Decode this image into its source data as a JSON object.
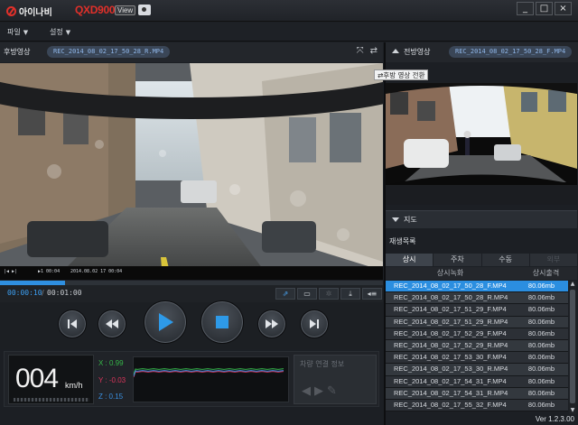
{
  "app": {
    "logo_text": "아이나비",
    "model": "QXD900",
    "view_badge": "View",
    "version": "Ver 1.2.3.00"
  },
  "window_buttons": [
    "_",
    "□",
    "×"
  ],
  "menu": {
    "file": "파일",
    "settings": "설정"
  },
  "rear_view": {
    "label": "후방영상",
    "filename": "REC_2014_08_02_17_50_28_R.MP4",
    "overlay_left": "|◀ ▶|",
    "overlay_mid": "▶1 00:04",
    "overlay_stamp": "2014.08.02 17 00:04"
  },
  "front_view": {
    "label": "전방영상",
    "filename": "REC_2014_08_02_17_50_28_F.MP4",
    "switch_tooltip": "후방 영상 전환"
  },
  "playback": {
    "current_time": "00:00:10",
    "separator": "/",
    "total_time": "00:01:00",
    "progress": 0.17
  },
  "sensor": {
    "speed": "004",
    "speed_unit": "km/h",
    "x_label": "X : 0.99",
    "y_label": "Y : -0.03",
    "z_label": "Z : 0.15",
    "colors": {
      "x": "#35b548",
      "y": "#d8345a",
      "z": "#3a8fe0"
    }
  },
  "car_info": {
    "label": "차량 연결 정보"
  },
  "map": {
    "label": "지도"
  },
  "playlist": {
    "title": "재생목록",
    "tabs": [
      "상시",
      "주차",
      "수동",
      "외부"
    ],
    "columns": [
      "상시녹화",
      "상시출격"
    ],
    "rows": [
      {
        "name": "REC_2014_08_02_17_50_28_F.MP4",
        "size": "80.06mb"
      },
      {
        "name": "REC_2014_08_02_17_50_28_R.MP4",
        "size": "80.06mb"
      },
      {
        "name": "REC_2014_08_02_17_51_29_F.MP4",
        "size": "80.06mb"
      },
      {
        "name": "REC_2014_08_02_17_51_29_R.MP4",
        "size": "80.06mb"
      },
      {
        "name": "REC_2014_08_02_17_52_29_F.MP4",
        "size": "80.06mb"
      },
      {
        "name": "REC_2014_08_02_17_52_29_R.MP4",
        "size": "80.06mb"
      },
      {
        "name": "REC_2014_08_02_17_53_30_F.MP4",
        "size": "80.06mb"
      },
      {
        "name": "REC_2014_08_02_17_53_30_R.MP4",
        "size": "80.06mb"
      },
      {
        "name": "REC_2014_08_02_17_54_31_F.MP4",
        "size": "80.06mb"
      },
      {
        "name": "REC_2014_08_02_17_54_31_R.MP4",
        "size": "80.06mb"
      },
      {
        "name": "REC_2014_08_02_17_55_32_F.MP4",
        "size": "80.06mb"
      }
    ]
  }
}
